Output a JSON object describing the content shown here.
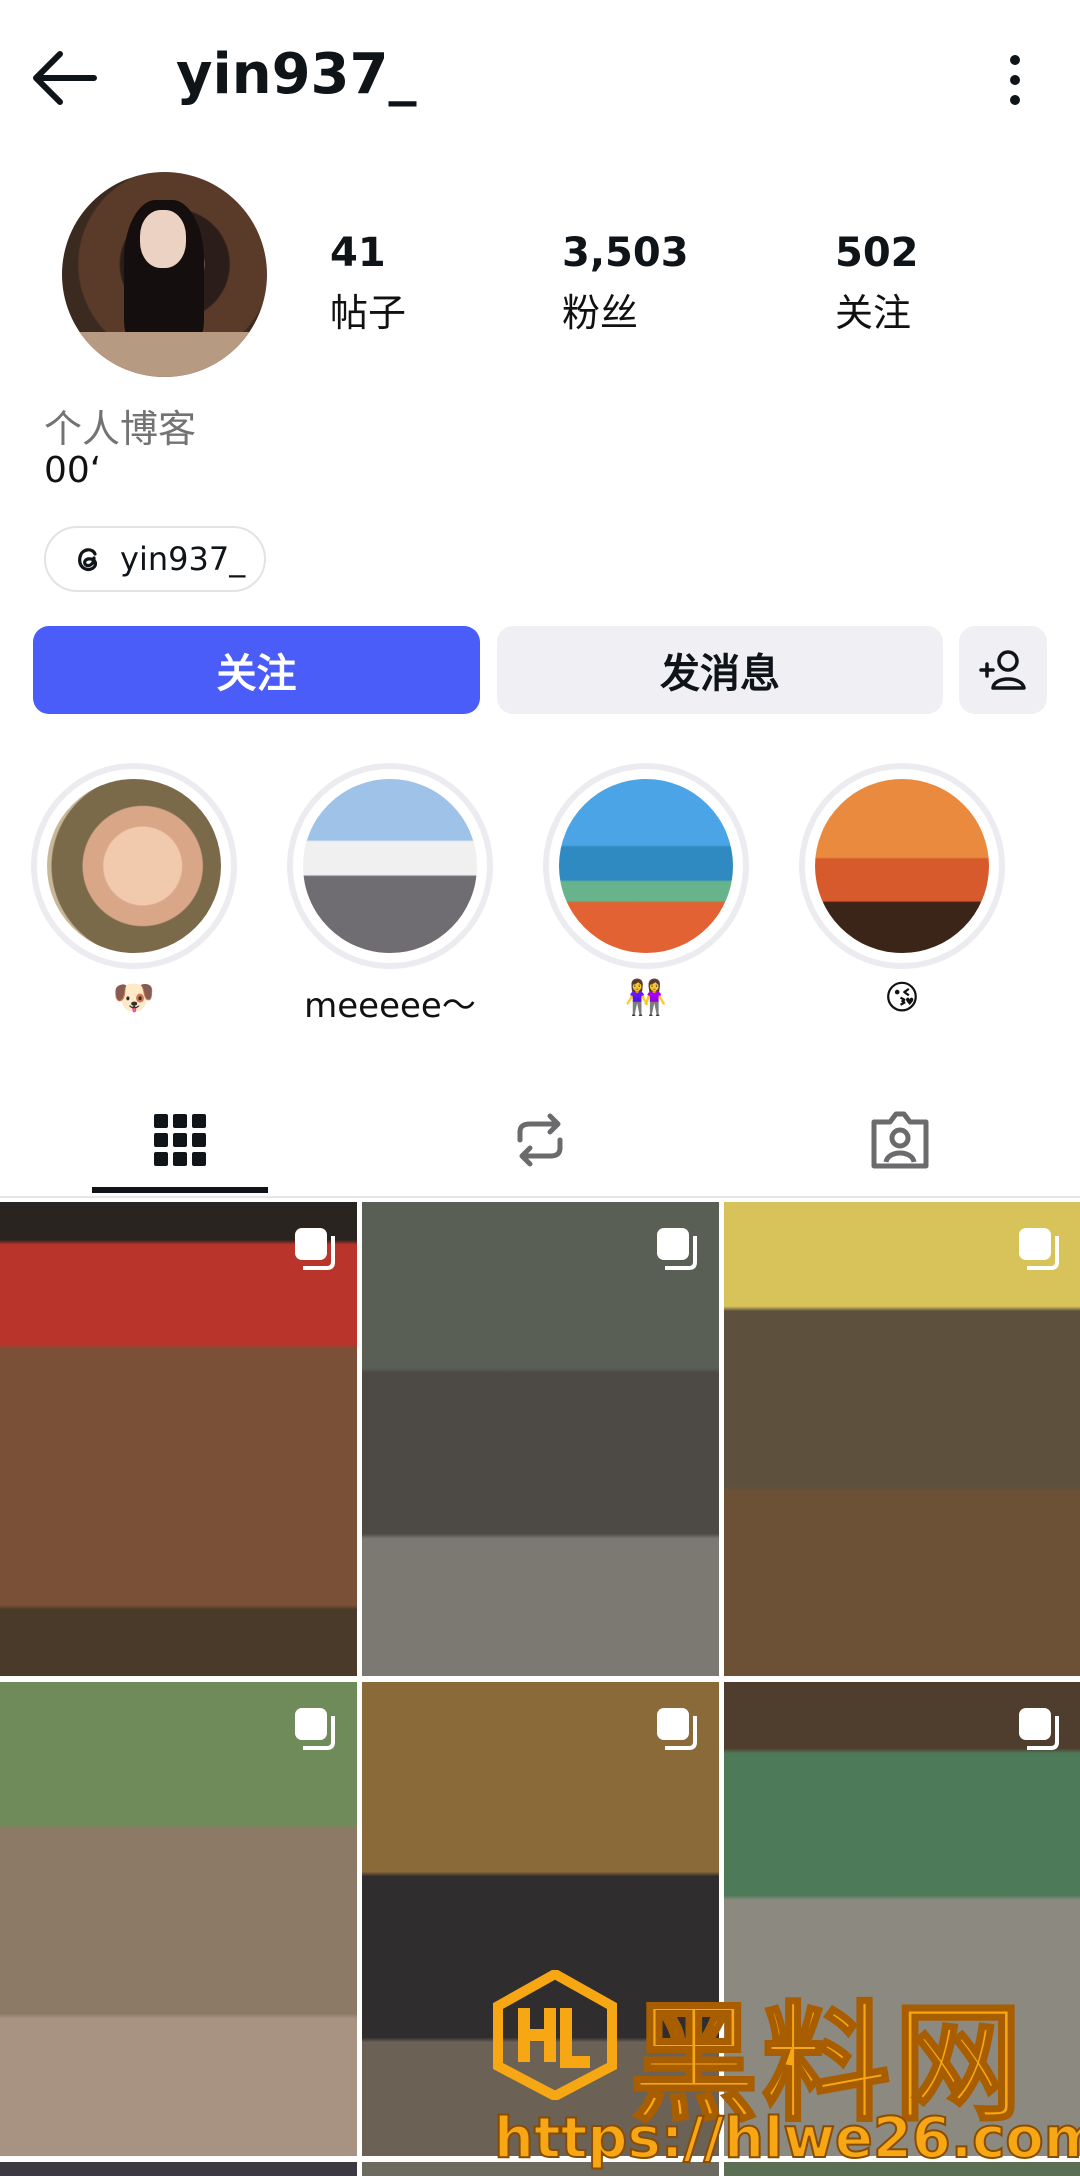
{
  "header": {
    "username": "yin937_"
  },
  "profile": {
    "stats": [
      {
        "value": "41",
        "label": "帖子"
      },
      {
        "value": "3,503",
        "label": "粉丝"
      },
      {
        "value": "502",
        "label": "关注"
      }
    ],
    "bio_category": "个人博客",
    "bio_text": "00ʻ",
    "threads_handle": "yin937_"
  },
  "actions": {
    "follow": "关注",
    "message": "发消息"
  },
  "highlights": [
    {
      "label": "🐶"
    },
    {
      "label": "meeeee～"
    },
    {
      "label": "👭"
    },
    {
      "label": "😘"
    }
  ],
  "tabs": [
    "grid-icon",
    "reels-repost-icon",
    "tagged-icon"
  ],
  "watermark": {
    "brand": "黑料网",
    "url": "https://hlwe26.com"
  },
  "colors": {
    "accent": "#4a5df9",
    "secondary_button": "#efeff4"
  }
}
